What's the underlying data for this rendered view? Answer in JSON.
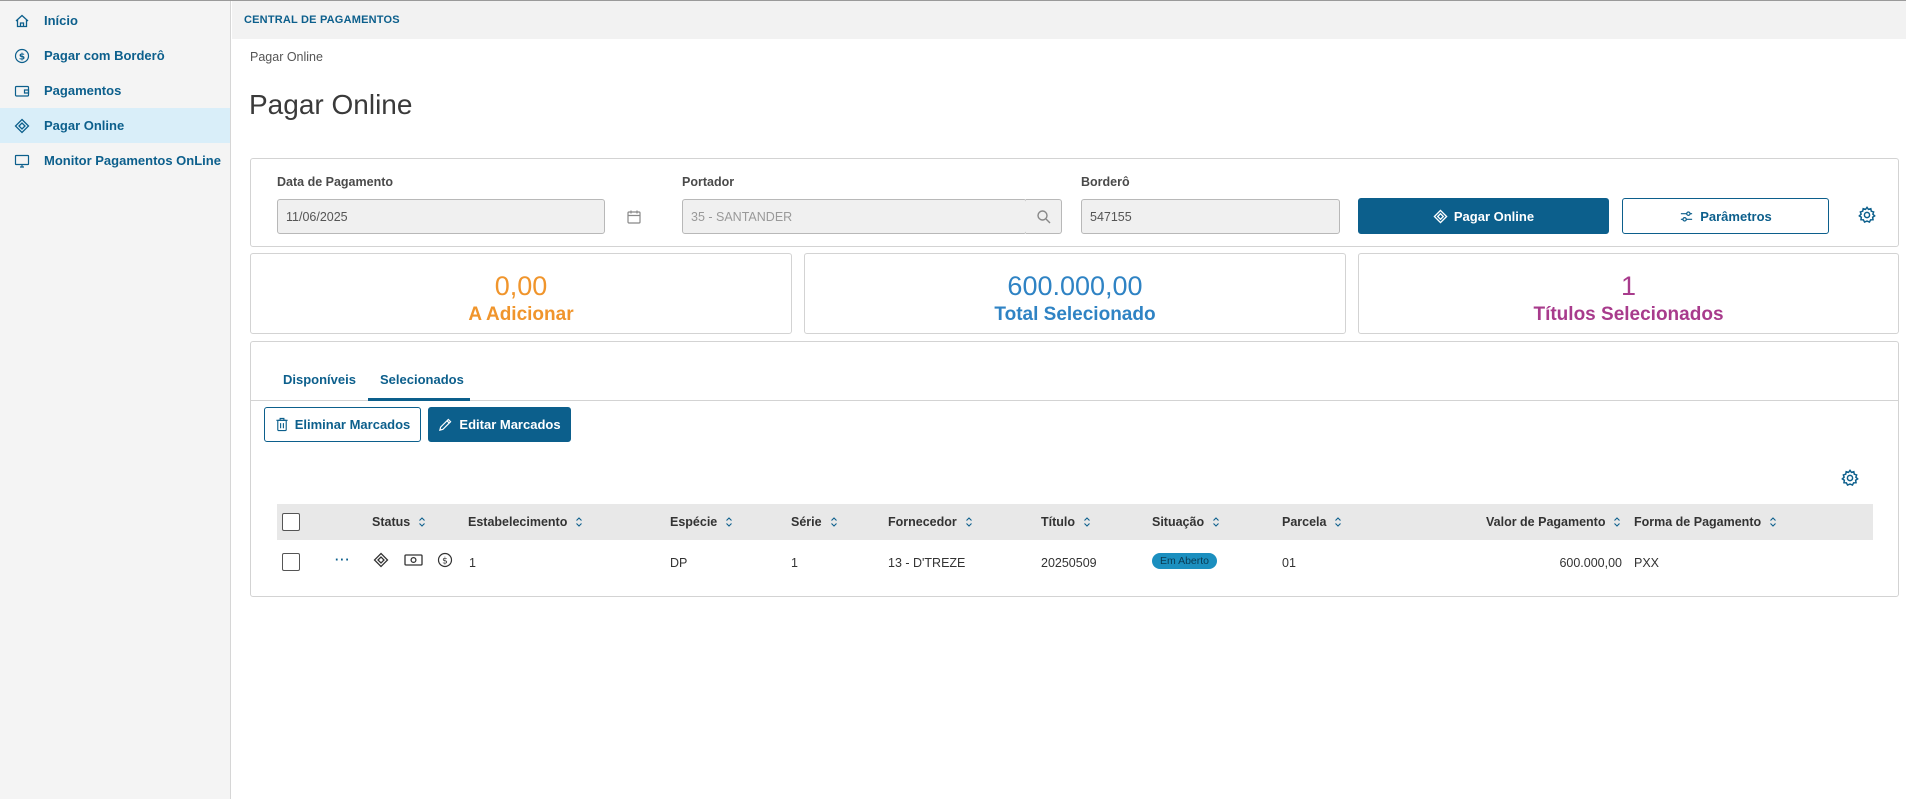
{
  "sidebar": {
    "items": [
      {
        "label": "Início",
        "icon": "home-icon"
      },
      {
        "label": "Pagar com Borderô",
        "icon": "dollar-circle-icon"
      },
      {
        "label": "Pagamentos",
        "icon": "wallet-icon"
      },
      {
        "label": "Pagar Online",
        "icon": "pix-diamond-icon",
        "active": true
      },
      {
        "label": "Monitor Pagamentos OnLine",
        "icon": "monitor-icon"
      }
    ]
  },
  "header": {
    "app_title": "CENTRAL DE PAGAMENTOS",
    "breadcrumb": "Pagar Online",
    "page_title": "Pagar Online"
  },
  "filters": {
    "date_label": "Data de Pagamento",
    "date_value": "11/06/2025",
    "portador_label": "Portador",
    "portador_value": "35 - SANTANDER",
    "bordero_label": "Borderô",
    "bordero_value": "547155",
    "pay_button": "Pagar Online",
    "params_button": "Parâmetros"
  },
  "kpis": [
    {
      "value": "0,00",
      "label": "A Adicionar",
      "color": "#f0952c"
    },
    {
      "value": "600.000,00",
      "label": "Total Selecionado",
      "color": "#2f83c4"
    },
    {
      "value": "1",
      "label": "Títulos Selecionados",
      "color": "#a83b8c"
    }
  ],
  "tabs": [
    {
      "label": "Disponíveis"
    },
    {
      "label": "Selecionados",
      "active": true
    }
  ],
  "actions": {
    "delete_marked": "Eliminar Marcados",
    "edit_marked": "Editar Marcados"
  },
  "table": {
    "columns": [
      "Status",
      "Estabelecimento",
      "Espécie",
      "Série",
      "Fornecedor",
      "Título",
      "Situação",
      "Parcela",
      "Valor de Pagamento",
      "Forma de Pagamento"
    ],
    "rows": [
      {
        "more": "···",
        "estabelecimento": "1",
        "especie": "DP",
        "serie": "1",
        "fornecedor": "13 - D'TREZE",
        "titulo": "20250509",
        "situacao": "Em Aberto",
        "parcela": "01",
        "valor": "600.000,00",
        "forma": "PXX"
      }
    ]
  },
  "colors": {
    "brand": "#0c5f8c",
    "active_nav": "#d9eef9",
    "badge": "#1b8fbf"
  }
}
